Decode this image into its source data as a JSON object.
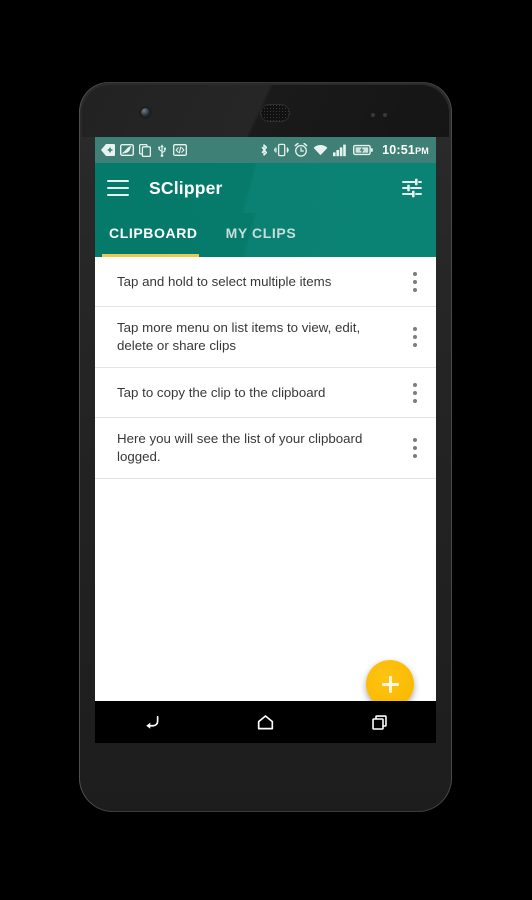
{
  "status_bar": {
    "time": "10:51",
    "ampm": "PM",
    "icons_left": [
      "back-arrow-notification-icon",
      "eco-mode-icon",
      "copy-notification-icon",
      "usb-icon",
      "developer-options-icon"
    ],
    "icons_right": [
      "bluetooth-icon",
      "vibrate-icon",
      "alarm-icon",
      "wifi-icon",
      "signal-icon",
      "battery-charging-icon"
    ]
  },
  "app_bar": {
    "title": "SClipper",
    "menu_icon": "hamburger-menu-icon",
    "action_icon": "tune-settings-icon"
  },
  "tabs": [
    {
      "label": "CLIPBOARD",
      "active": true
    },
    {
      "label": "MY CLIPS",
      "active": false
    }
  ],
  "list_items": [
    {
      "text": "Tap and hold to select multiple items",
      "lines": 1
    },
    {
      "text": "Tap more menu on list items to view, edit, delete or share clips",
      "lines": 2
    },
    {
      "text": "Tap to copy the clip to the clipboard",
      "lines": 1
    },
    {
      "text": "Here you will see the list of your clipboard logged.",
      "lines": 2
    }
  ],
  "fab": {
    "icon": "plus-icon",
    "label": "Add clip"
  },
  "nav_bar": {
    "back": "back-nav-icon",
    "home": "home-nav-icon",
    "recents": "recents-nav-icon"
  },
  "colors": {
    "app_bar_teal": "#067b6b",
    "status_bar_teal": "#3f8076",
    "tab_indicator_yellow": "#ecc94f",
    "fab_amber": "#fbbc05",
    "list_text": "#38383a",
    "divider": "#e4e4e4"
  }
}
